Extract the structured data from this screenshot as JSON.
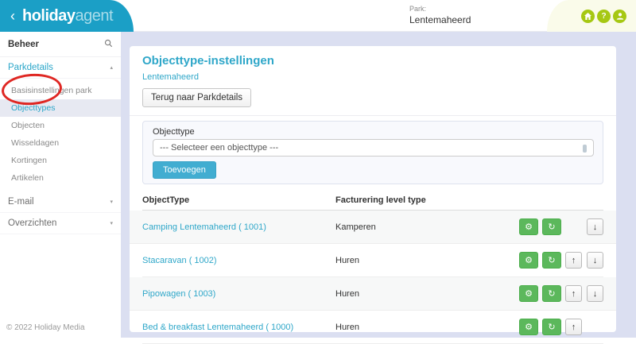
{
  "colors": {
    "header_teal": "#1b9fc6",
    "lime_icon_green": "#a6c813",
    "accent_teal": "#2fa7c9",
    "button_green": "#5cb85c",
    "annotation_red": "#df2723",
    "content_background": "#dbdff1"
  },
  "header": {
    "back_chevron": "‹",
    "brand_primary": "holiday",
    "brand_secondary": "agent",
    "park_label": "Park:",
    "park_name": "Lentemaheerd",
    "help_glyph": "?"
  },
  "sidebar": {
    "section_title": "Beheer",
    "parkdetails_label": "Parkdetails",
    "parkdetails_caret": "▴",
    "subitems": [
      {
        "label": "Basisinstellingen park"
      },
      {
        "label": "Objecttypes"
      },
      {
        "label": "Objecten"
      },
      {
        "label": "Wisseldagen"
      },
      {
        "label": "Kortingen"
      },
      {
        "label": "Artikelen"
      }
    ],
    "active_subitem": "Objecttypes",
    "collapsed_sections": [
      {
        "label": "E-mail",
        "caret": "▾"
      },
      {
        "label": "Overzichten",
        "caret": "▾"
      }
    ],
    "copyright": "© 2022 Holiday Media"
  },
  "main": {
    "title": "Objecttype-instellingen",
    "park_link": "Lentemaheerd",
    "back_button": "Terug naar Parkdetails",
    "form": {
      "label": "Objecttype",
      "select_value": "--- Selecteer een objecttype ---",
      "submit_label": "Toevoegen"
    },
    "table": {
      "headers": [
        "ObjectType",
        "Facturering level type"
      ],
      "rows": [
        {
          "name": "Camping Lentemaheerd ( 1001)",
          "billing_type": "Kamperen",
          "has_up": false,
          "has_down": true
        },
        {
          "name": "Stacaravan ( 1002)",
          "billing_type": "Huren",
          "has_up": true,
          "has_down": true
        },
        {
          "name": "Pipowagen ( 1003)",
          "billing_type": "Huren",
          "has_up": true,
          "has_down": true
        },
        {
          "name": "Bed & breakfast Lentemaheerd ( 1000)",
          "billing_type": "Huren",
          "has_up": true,
          "has_down": false
        }
      ]
    },
    "icons": {
      "settings": "⚙",
      "refresh": "↻",
      "up": "↑",
      "down": "↓"
    }
  }
}
